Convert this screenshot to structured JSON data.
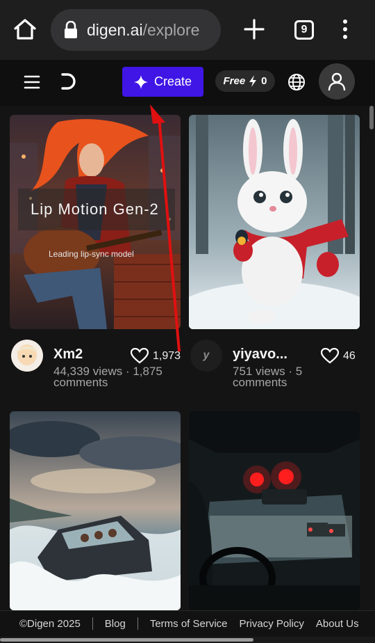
{
  "browser": {
    "url_host": "digen.ai",
    "url_path": "/explore",
    "tab_count": "9"
  },
  "header": {
    "create_label": "Create",
    "credits_label": "Free",
    "credits_count": "0"
  },
  "cards": [
    {
      "overlay_title": "Lip Motion Gen-2",
      "overlay_subtitle": "Leading lip-sync model",
      "author": "Xm2",
      "likes": "1,973",
      "stats": "44,339 views · 1,875 comments",
      "avatar_letter": ""
    },
    {
      "author": "yiyavo...",
      "likes": "46",
      "stats": "751 views · 5 comments",
      "avatar_letter": "y"
    },
    {
      "author": "",
      "likes": "",
      "stats": ""
    },
    {
      "author": "",
      "likes": "",
      "stats": ""
    }
  ],
  "footer": {
    "copyright": "©Digen 2025",
    "links": [
      "Blog",
      "Terms of Service",
      "Privacy Policy",
      "About Us"
    ]
  },
  "colors": {
    "create_button": "#3f16e6",
    "background": "#141414",
    "annotation_arrow": "#e01010"
  }
}
